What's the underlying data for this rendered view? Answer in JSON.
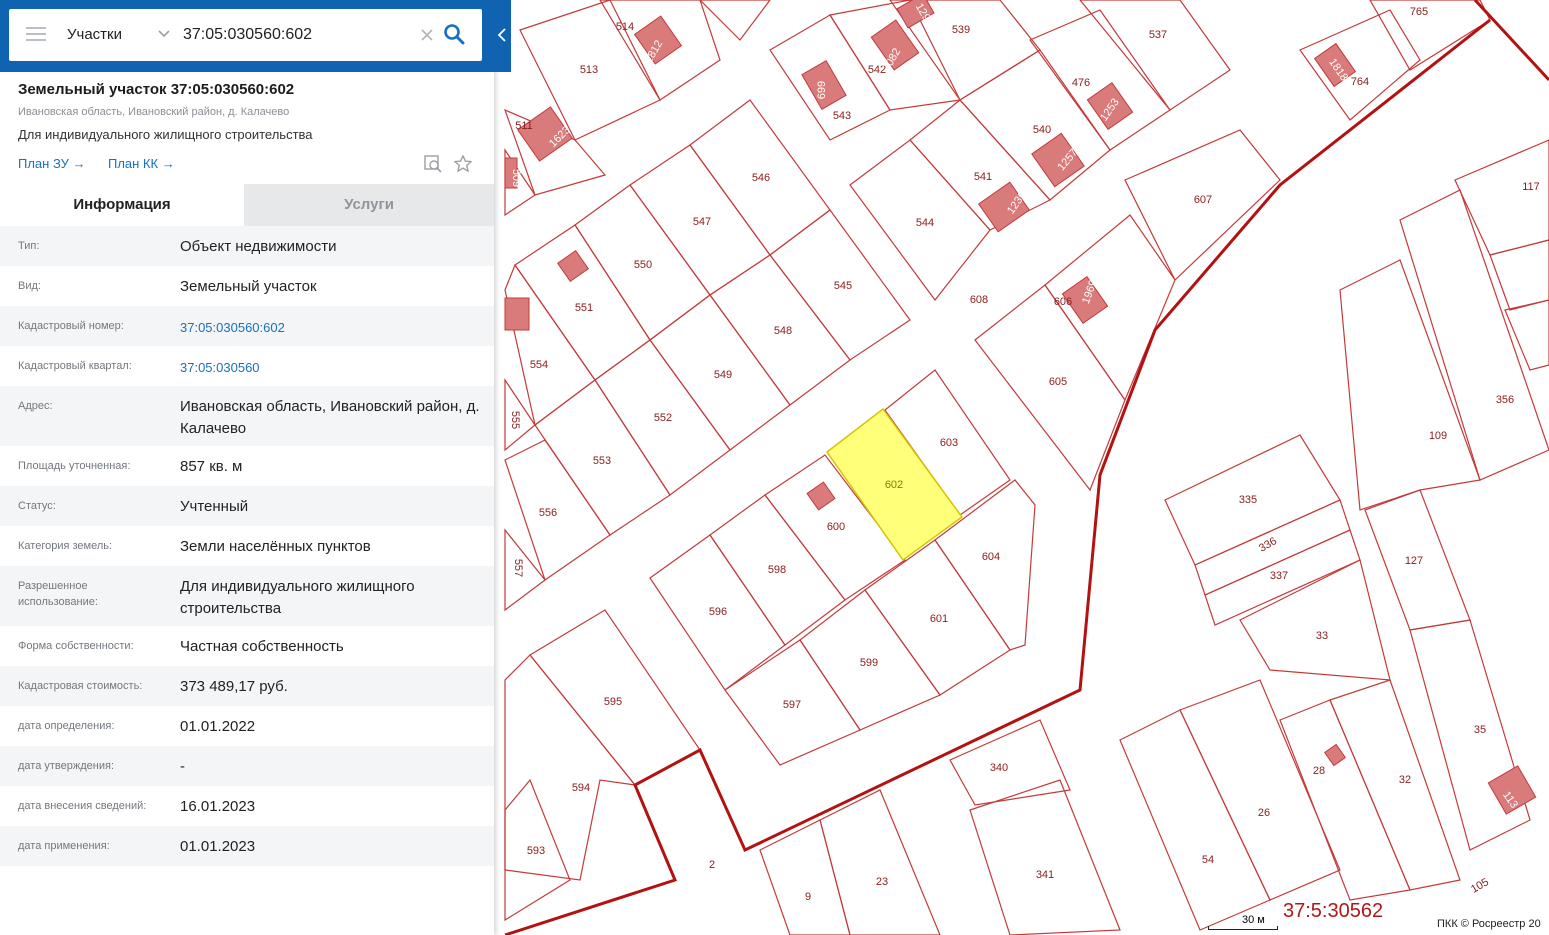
{
  "search": {
    "layer": "Участки",
    "query": "37:05:030560:602"
  },
  "object": {
    "title": "Земельный участок 37:05:030560:602",
    "address_short": "Ивановская область, Ивановский район, д. Калачево",
    "purpose": "Для индивидуального жилищного строительства",
    "link_plan_zu": "План ЗУ →",
    "link_plan_kk": "План КК →"
  },
  "tabs": [
    {
      "label": "Информация",
      "active": true
    },
    {
      "label": "Услуги",
      "active": false
    }
  ],
  "rows": [
    {
      "label": "Тип:",
      "value": "Объект недвижимости"
    },
    {
      "label": "Вид:",
      "value": "Земельный участок"
    },
    {
      "label": "Кадастровый номер:",
      "value": "37:05:030560:602",
      "link": true
    },
    {
      "label": "Кадастровый квартал:",
      "value": "37:05:030560",
      "link": true
    },
    {
      "label": "Адрес:",
      "value": "Ивановская область, Ивановский район, д. Калачево"
    },
    {
      "label": "Площадь уточненная:",
      "value": "857 кв. м"
    },
    {
      "label": "Статус:",
      "value": "Учтенный"
    },
    {
      "label": "Категория земель:",
      "value": "Земли населённых пунктов"
    },
    {
      "label": "Разрешенное использование:",
      "value": "Для индивидуального жилищного строительства"
    },
    {
      "label": "Форма собственности:",
      "value": "Частная собственность"
    },
    {
      "label": "Кадастровая стоимость:",
      "value": "373 489,17 руб."
    },
    {
      "label": "дата определения:",
      "value": "01.01.2022"
    },
    {
      "label": "дата утверждения:",
      "value": "-"
    },
    {
      "label": "дата внесения сведений:",
      "value": "16.01.2023"
    },
    {
      "label": "дата применения:",
      "value": "01.01.2023"
    }
  ],
  "map": {
    "selected_parcel": "602",
    "quarter_label": "37:5:30562",
    "scale_label": "30 м",
    "copyright": "ПКК © Росреестр 20",
    "colors": {
      "parcel_line": "#c43a3a",
      "building_fill": "#d97b7b",
      "selected_fill": "#ffff7a",
      "boundary": "#b21212"
    },
    "parcel_labels": [
      "513",
      "514",
      "1812",
      "1298",
      "539",
      "537",
      "765",
      "511",
      "1623",
      "509",
      "542",
      "2082",
      "699",
      "543",
      "476",
      "1253",
      "1818",
      "764",
      "540",
      "1257",
      "546",
      "541",
      "1236",
      "544",
      "547",
      "607",
      "117",
      "550",
      "551",
      "545",
      "608",
      "606",
      "1969",
      "548",
      "554",
      "549",
      "605",
      "356",
      "555",
      "552",
      "603",
      "109",
      "553",
      "602",
      "335",
      "556",
      "600",
      "336",
      "337",
      "598",
      "604",
      "127",
      "557",
      "596",
      "601",
      "33",
      "599",
      "595",
      "597",
      "340",
      "28",
      "32",
      "35",
      "594",
      "26",
      "341",
      "54",
      "593",
      "2",
      "9",
      "23",
      "105",
      "113"
    ]
  }
}
